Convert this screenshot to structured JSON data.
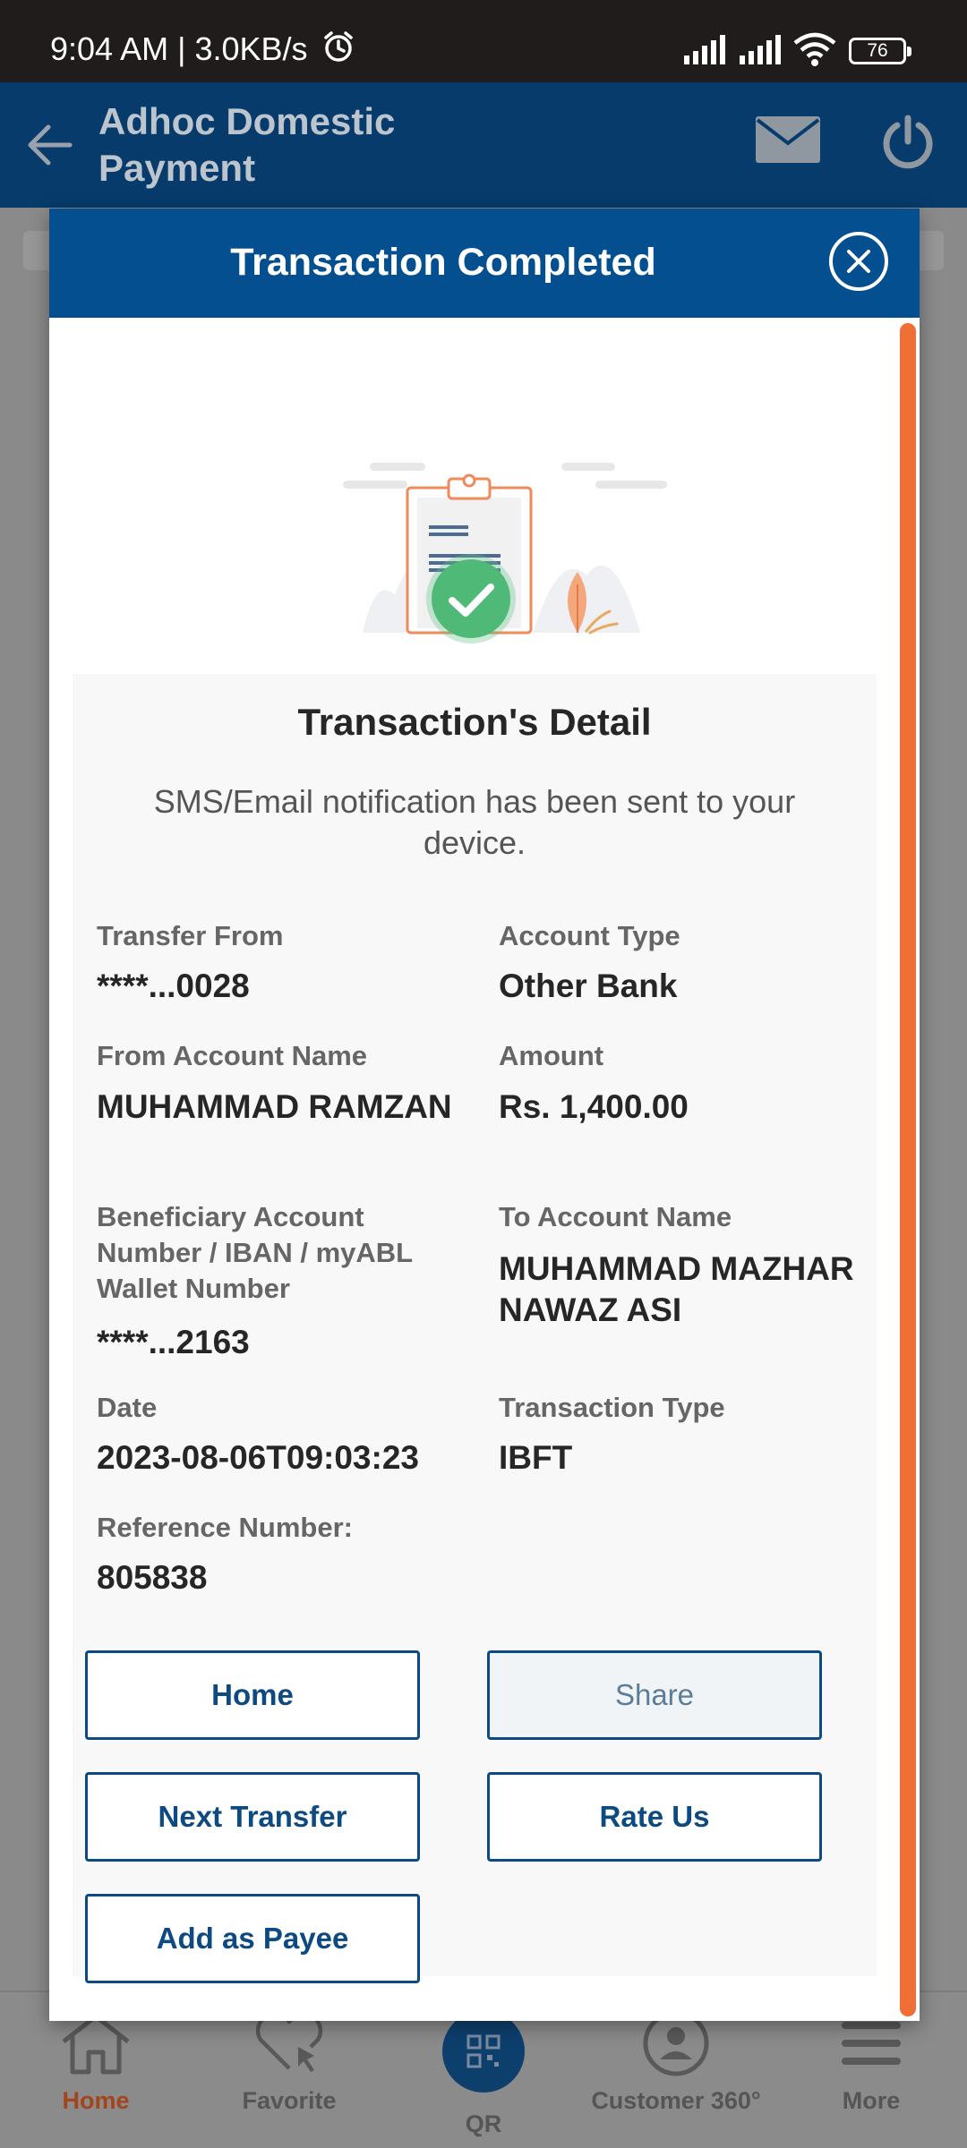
{
  "status_bar": {
    "time": "9:04 AM | 3.0KB/s",
    "battery": "76"
  },
  "app_header": {
    "title": "Adhoc Domestic Payment"
  },
  "modal": {
    "title": "Transaction Completed",
    "detail_title": "Transaction's Detail",
    "notification": "SMS/Email notification has been sent to your device.",
    "fields": {
      "transfer_from": {
        "label": "Transfer From",
        "value": "****...0028"
      },
      "account_type": {
        "label": "Account Type",
        "value": "Other Bank"
      },
      "from_account_name": {
        "label": "From Account Name",
        "value": "MUHAMMAD RAMZAN"
      },
      "amount": {
        "label": "Amount",
        "value": "Rs. 1,400.00"
      },
      "beneficiary": {
        "label": "Beneficiary Account Number / IBAN / myABL Wallet Number",
        "value": "****...2163"
      },
      "to_account_name": {
        "label": "To Account Name",
        "value": "MUHAMMAD MAZHAR NAWAZ ASI"
      },
      "date": {
        "label": "Date",
        "value": "2023-08-06T09:03:23"
      },
      "transaction_type": {
        "label": "Transaction Type",
        "value": "IBFT"
      },
      "reference_number": {
        "label": "Reference Number:",
        "value": "805838"
      }
    },
    "buttons": {
      "home": "Home",
      "share": "Share",
      "next_transfer": "Next Transfer",
      "rate_us": "Rate Us",
      "add_as_payee": "Add as Payee"
    }
  },
  "bottom_nav": {
    "items": [
      {
        "label": "Home",
        "icon": "home-icon",
        "active": true
      },
      {
        "label": "Favorite",
        "icon": "heart-cursor-icon"
      },
      {
        "label": "QR",
        "icon": "qr-icon"
      },
      {
        "label": "Customer 360°",
        "icon": "user-circle-icon"
      },
      {
        "label": "More",
        "icon": "menu-icon"
      }
    ]
  },
  "colors": {
    "header_blue": "#044f8f",
    "app_bar": "#063b6b",
    "accent_orange": "#ef6f37",
    "success_green": "#4fba77",
    "button_border": "#0d4a82"
  }
}
